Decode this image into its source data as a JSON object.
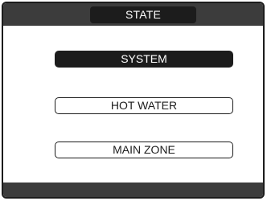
{
  "header": {
    "title": "STATE"
  },
  "menu": {
    "items": [
      {
        "label": "SYSTEM",
        "selected": true
      },
      {
        "label": "HOT WATER",
        "selected": false
      },
      {
        "label": "MAIN ZONE",
        "selected": false
      }
    ]
  },
  "colors": {
    "bar": "#3c3c3c",
    "selected_bg": "#1c1c1c",
    "background": "#ffffff"
  }
}
